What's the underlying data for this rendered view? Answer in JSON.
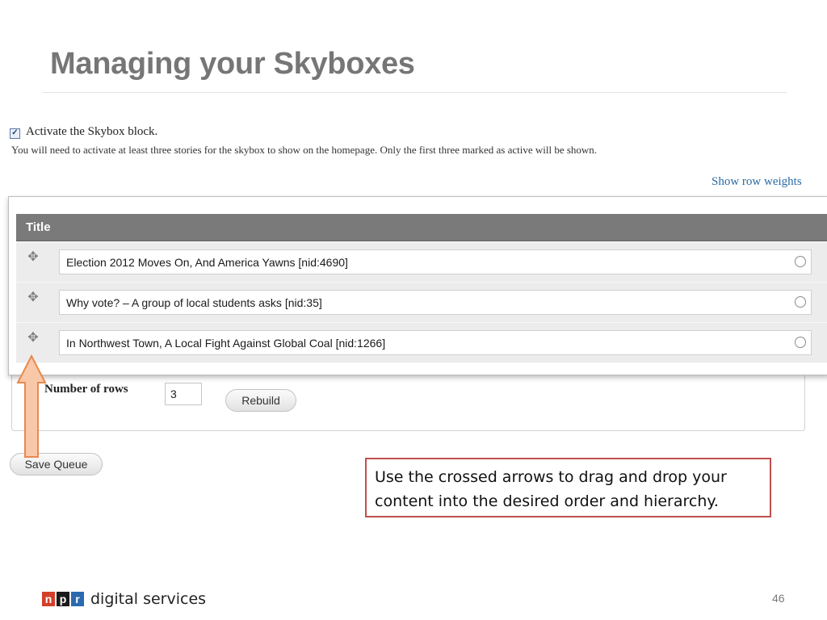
{
  "slide": {
    "title": "Managing your Skyboxes",
    "page_number": "46"
  },
  "form": {
    "activate": {
      "checked": true,
      "label": "Activate the Skybox block.",
      "help": "You will need to activate at least three stories for the skybox to show on the homepage. Only the first three marked as active will be shown."
    },
    "show_row_weights": "Show row weights",
    "table": {
      "header": "Title",
      "rows": [
        {
          "title": "Election 2012 Moves On, And America Yawns [nid:4690]"
        },
        {
          "title": "Why vote? – A group of local students asks [nid:35]"
        },
        {
          "title": "In Northwest Town, A Local Fight Against Global Coal [nid:1266]"
        }
      ]
    },
    "number_of_rows_label": "Number of rows",
    "number_of_rows_value": "3",
    "rebuild_label": "Rebuild",
    "save_label": "Save Queue"
  },
  "callout": {
    "text": "Use the crossed arrows to drag and drop your content into the desired order and hierarchy."
  },
  "footer": {
    "logo_letters": [
      "n",
      "p",
      "r"
    ],
    "logo_text": "digital services"
  },
  "colors": {
    "title_gray": "#767676",
    "header_gray": "#7a7a7a",
    "row_gray": "#ececec",
    "link_blue": "#2a6aa5",
    "callout_border": "#c0504d",
    "arrow_fill": "#f9c8a8",
    "arrow_stroke": "#e8894e",
    "npr_red": "#d43f2a",
    "npr_black": "#1a1a1a",
    "npr_blue": "#2a6ab0"
  },
  "icons": {
    "drag": "move-arrows-icon",
    "active": "radio-icon",
    "callout": "up-arrow-icon"
  }
}
